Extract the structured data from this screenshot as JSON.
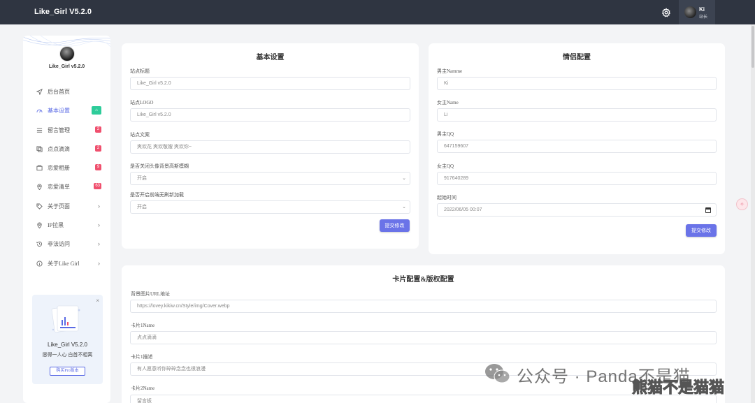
{
  "topbar": {
    "brand": "Like_Girl V5.2.0",
    "user_name": "Ki",
    "user_role": "站长"
  },
  "sidebar": {
    "title": "Like_Girl v5.2.0",
    "items": [
      {
        "label": "后台首页",
        "icon": "send-icon"
      },
      {
        "label": "基本设置",
        "icon": "gauge-icon",
        "badge": "⌂",
        "badge_color": "green",
        "active": true
      },
      {
        "label": "留言管理",
        "icon": "list-icon",
        "badge": "2",
        "badge_color": "red"
      },
      {
        "label": "点点滴滴",
        "icon": "copy-icon",
        "badge": "2",
        "badge_color": "red"
      },
      {
        "label": "恋爱相册",
        "icon": "album-icon",
        "badge": "9",
        "badge_color": "red"
      },
      {
        "label": "恋爱清单",
        "icon": "pin-icon",
        "badge": "63",
        "badge_color": "red"
      },
      {
        "label": "关于页面",
        "icon": "tag-icon",
        "chevron": "›"
      },
      {
        "label": "IP拉黑",
        "icon": "pin-icon",
        "chevron": "›"
      },
      {
        "label": "非法访问",
        "icon": "history-icon",
        "chevron": "›"
      },
      {
        "label": "关于Like Girl",
        "icon": "info-icon",
        "chevron": "›"
      }
    ],
    "promo": {
      "close": "×",
      "title": "Like_Girl V5.2.0",
      "subtitle": "愿得一人心 白首不相离",
      "button": "购买Pro版本"
    }
  },
  "basic_settings": {
    "title": "基本设置",
    "fields": [
      {
        "label": "站点标题",
        "value": "Like_Girl v5.2.0"
      },
      {
        "label": "站点LOGO",
        "value": "Like_Girl v5.2.0"
      },
      {
        "label": "站点文案",
        "value": "爽欢花 爽欢敬嫂 爽欢你~"
      }
    ],
    "selects": [
      {
        "label": "是否关闭头像背景高斯模糊",
        "value": "开启",
        "arrow": "⌄"
      },
      {
        "label": "是否开启前端无刷新加载",
        "value": "开启",
        "arrow": "⌄"
      }
    ],
    "submit": "提交修改"
  },
  "couple_settings": {
    "title": "情侣配置",
    "fields": [
      {
        "label": "男主Namme",
        "value": "Ki"
      },
      {
        "label": "女主Name",
        "value": "Li"
      },
      {
        "label": "男主QQ",
        "value": "647159607"
      },
      {
        "label": "女主QQ",
        "value": "917640289"
      },
      {
        "label": "起始时间",
        "value": "2022/06/05 00:07"
      }
    ],
    "submit": "提交修改"
  },
  "card_settings": {
    "title": "卡片配置&版权配置",
    "fields": [
      {
        "label": "背景图片URL地址",
        "value": "https://lovey.kikiw.cn/Style/img/Cover.webp"
      },
      {
        "label": "卡片1Name",
        "value": "点点滴滴"
      },
      {
        "label": "卡片1描述",
        "value": "有人愿意听你碎碎念念也很浪漫"
      },
      {
        "label": "卡片2Name",
        "value": "留言板"
      }
    ]
  },
  "watermark": {
    "text": "公众号 · Panda不是猫",
    "text2": "熊猫不是猫猫"
  },
  "float_widget": "✧"
}
